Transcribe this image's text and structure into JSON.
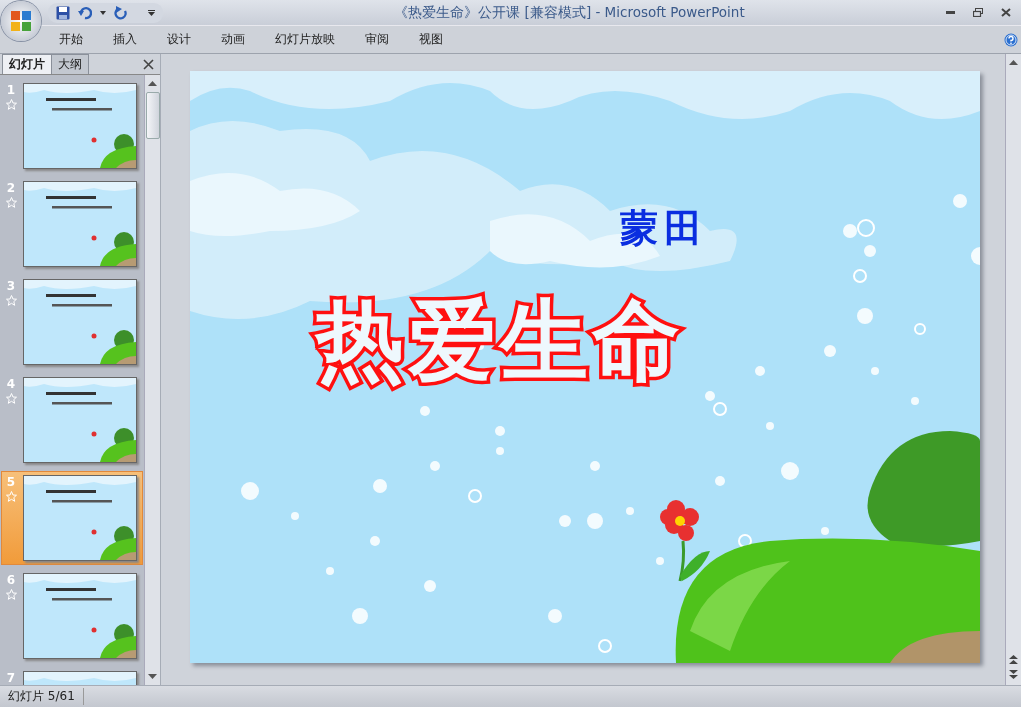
{
  "window": {
    "title": "《热爱生命》公开课 [兼容模式] - Microsoft PowerPoint"
  },
  "ribbon_tabs": [
    {
      "label": "开始",
      "selected": false
    },
    {
      "label": "插入",
      "selected": false
    },
    {
      "label": "设计",
      "selected": false
    },
    {
      "label": "动画",
      "selected": false
    },
    {
      "label": "幻灯片放映",
      "selected": false
    },
    {
      "label": "审阅",
      "selected": false
    },
    {
      "label": "视图",
      "selected": false
    }
  ],
  "panel_tabs": [
    {
      "label": "幻灯片",
      "selected": true
    },
    {
      "label": "大纲",
      "selected": false
    }
  ],
  "slides": [
    {
      "number": "1",
      "selected": false
    },
    {
      "number": "2",
      "selected": false
    },
    {
      "number": "3",
      "selected": false
    },
    {
      "number": "4",
      "selected": false
    },
    {
      "number": "5",
      "selected": true
    },
    {
      "number": "6",
      "selected": false
    },
    {
      "number": "7",
      "selected": false
    }
  ],
  "slide": {
    "author": "蒙田",
    "title": "热爱生命"
  },
  "status_bar": {
    "slide_indicator": "幻灯片 5/61"
  }
}
